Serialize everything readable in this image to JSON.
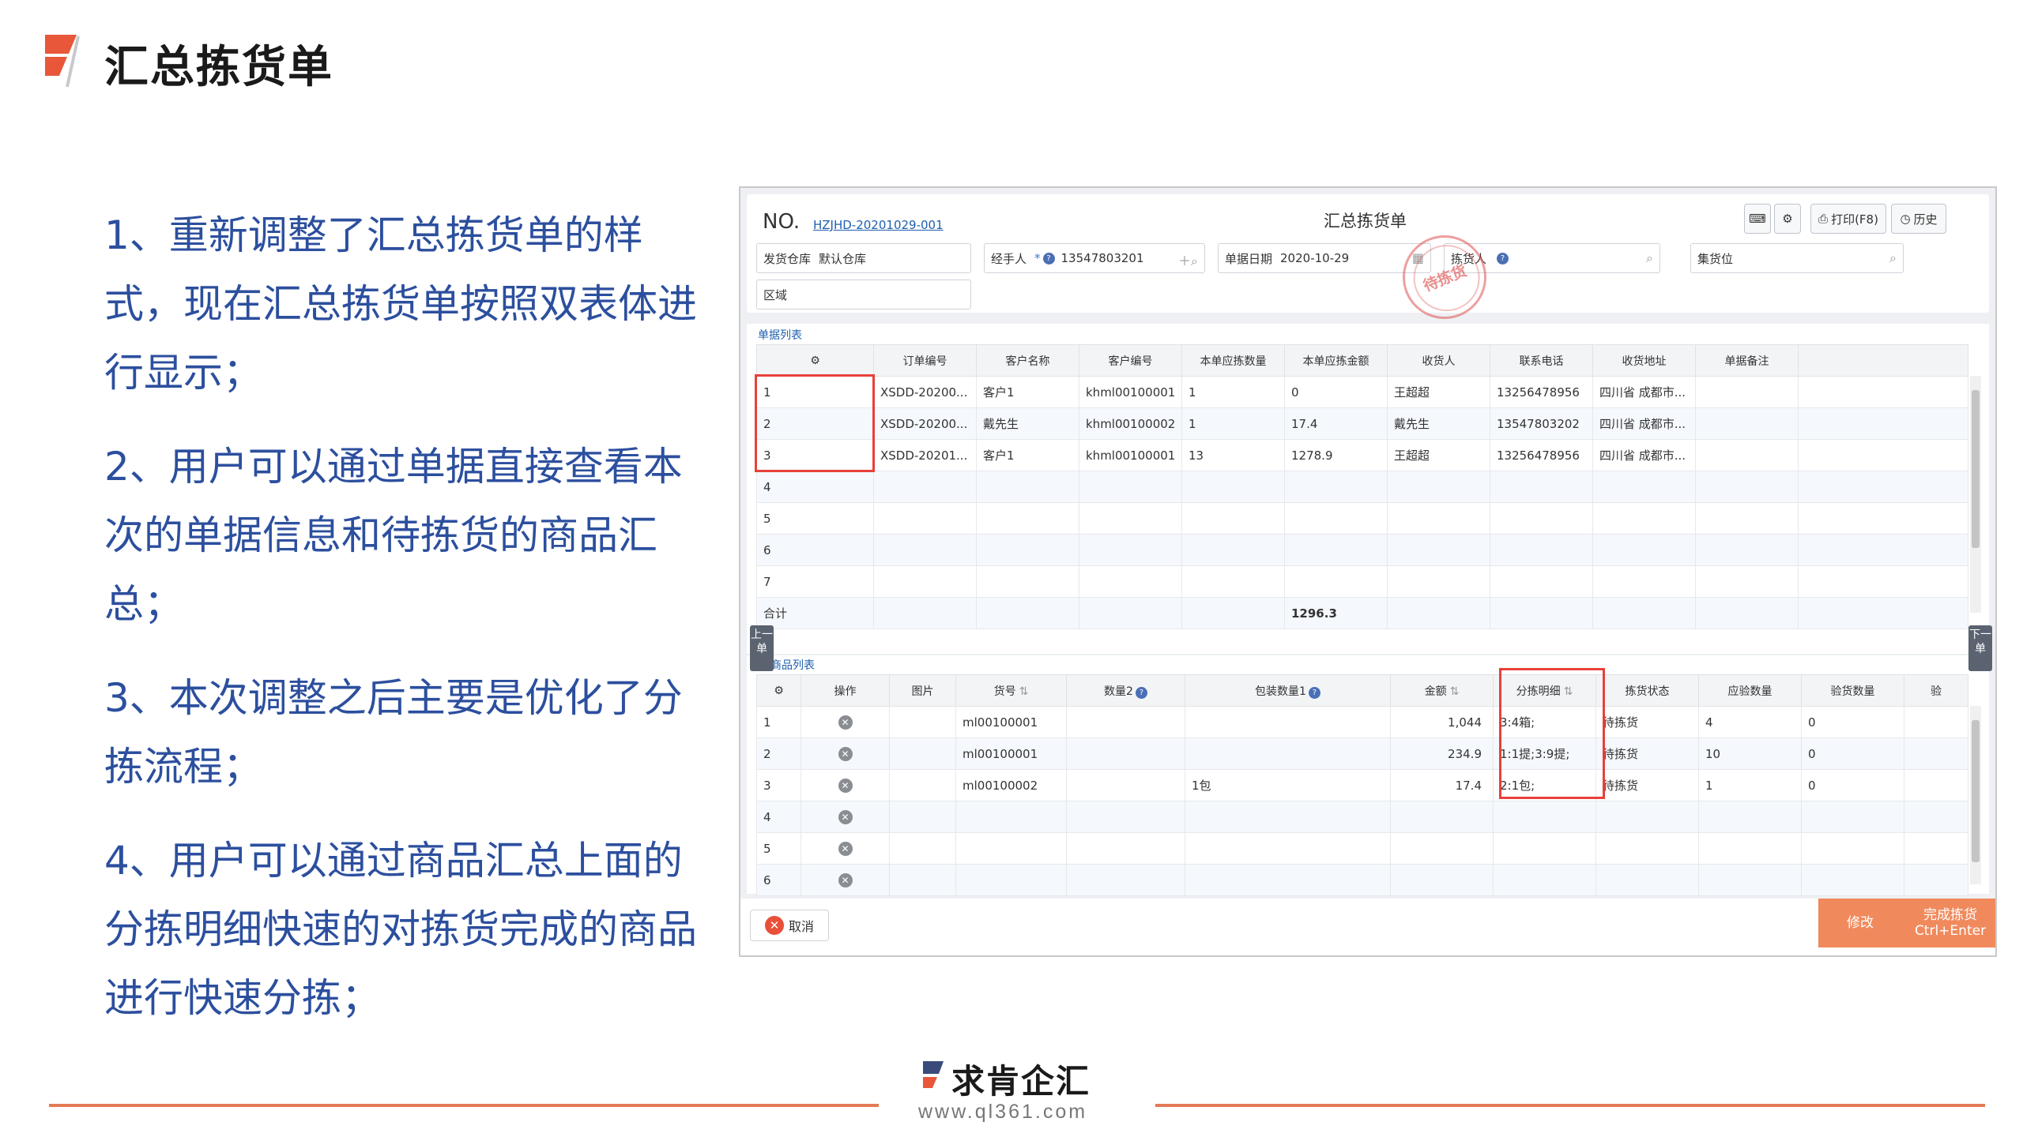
{
  "slide": {
    "title": "汇总拣货单",
    "points": [
      "1、重新调整了汇总拣货单的样式，现在汇总拣货单按照双表体进行显示；",
      "2、用户可以通过单据直接查看本次的单据信息和待拣货的商品汇总；",
      "3、本次调整之后主要是优化了分拣流程；",
      "4、用户可以通过商品汇总上面的分拣明细快速的对拣货完成的商品进行快速分拣；"
    ],
    "footer": {
      "brand": "求肯企汇",
      "url": "www.ql361.com"
    }
  },
  "form": {
    "no_label": "NO.",
    "no_value": "HZJHD-20201029-001",
    "title": "汇总拣货单",
    "buttons": {
      "print": "打印(F8)",
      "history": "历史"
    },
    "fields": {
      "warehouse_label": "发货仓库",
      "warehouse_value": "默认仓库",
      "handler_label": "经手人",
      "handler_value": "13547803201",
      "date_label": "单据日期",
      "date_value": "2020-10-29",
      "picker_label": "拣货人",
      "location_label": "集货位",
      "area_label": "区域"
    },
    "stamp_text": "待拣货"
  },
  "doc_table": {
    "section_label": "单据列表",
    "headers": [
      "订单编号",
      "客户名称",
      "客户编号",
      "本单应拣数量",
      "本单应拣金额",
      "收货人",
      "联系电话",
      "收货地址",
      "单据备注"
    ],
    "rows": [
      {
        "idx": "1",
        "order": "XSDD-20200...",
        "customer": "客户1",
        "cust_no": "khml00100001",
        "qty": "1",
        "amount": "0",
        "receiver": "王超超",
        "phone": "13256478956",
        "address": "四川省 成都市...",
        "note": ""
      },
      {
        "idx": "2",
        "order": "XSDD-20200...",
        "customer": "戴先生",
        "cust_no": "khml00100002",
        "qty": "1",
        "amount": "17.4",
        "receiver": "戴先生",
        "phone": "13547803202",
        "address": "四川省 成都市...",
        "note": ""
      },
      {
        "idx": "3",
        "order": "XSDD-20201...",
        "customer": "客户1",
        "cust_no": "khml00100001",
        "qty": "13",
        "amount": "1278.9",
        "receiver": "王超超",
        "phone": "13256478956",
        "address": "四川省 成都市...",
        "note": ""
      },
      {
        "idx": "4"
      },
      {
        "idx": "5"
      },
      {
        "idx": "6"
      },
      {
        "idx": "7"
      }
    ],
    "total_label": "合计",
    "total_amount": "1296.3"
  },
  "goods_table": {
    "section_label": "商品列表",
    "headers": [
      "操作",
      "图片",
      "货号",
      "数量2",
      "包装数量1",
      "金额",
      "分拣明细",
      "拣货状态",
      "应验数量",
      "验货数量",
      "验"
    ],
    "rows": [
      {
        "idx": "1",
        "sku": "ml00100001",
        "pack": "",
        "amount": "1,044",
        "detail": "3:4箱;",
        "status": "待拣货",
        "check_qty": "4",
        "checked": "0"
      },
      {
        "idx": "2",
        "sku": "ml00100001",
        "pack": "",
        "amount": "234.9",
        "detail": "1:1提;3:9提;",
        "status": "待拣货",
        "check_qty": "10",
        "checked": "0"
      },
      {
        "idx": "3",
        "sku": "ml00100002",
        "pack": "1包",
        "amount": "17.4",
        "detail": "2:1包;",
        "status": "待拣货",
        "check_qty": "1",
        "checked": "0"
      },
      {
        "idx": "4"
      },
      {
        "idx": "5"
      },
      {
        "idx": "6"
      }
    ]
  },
  "side_tabs": {
    "prev": "上一单",
    "next": "下一单"
  },
  "actions": {
    "cancel": "取消",
    "modify": "修改",
    "finish": "完成拣货",
    "finish_hint": "Ctrl+Enter"
  }
}
